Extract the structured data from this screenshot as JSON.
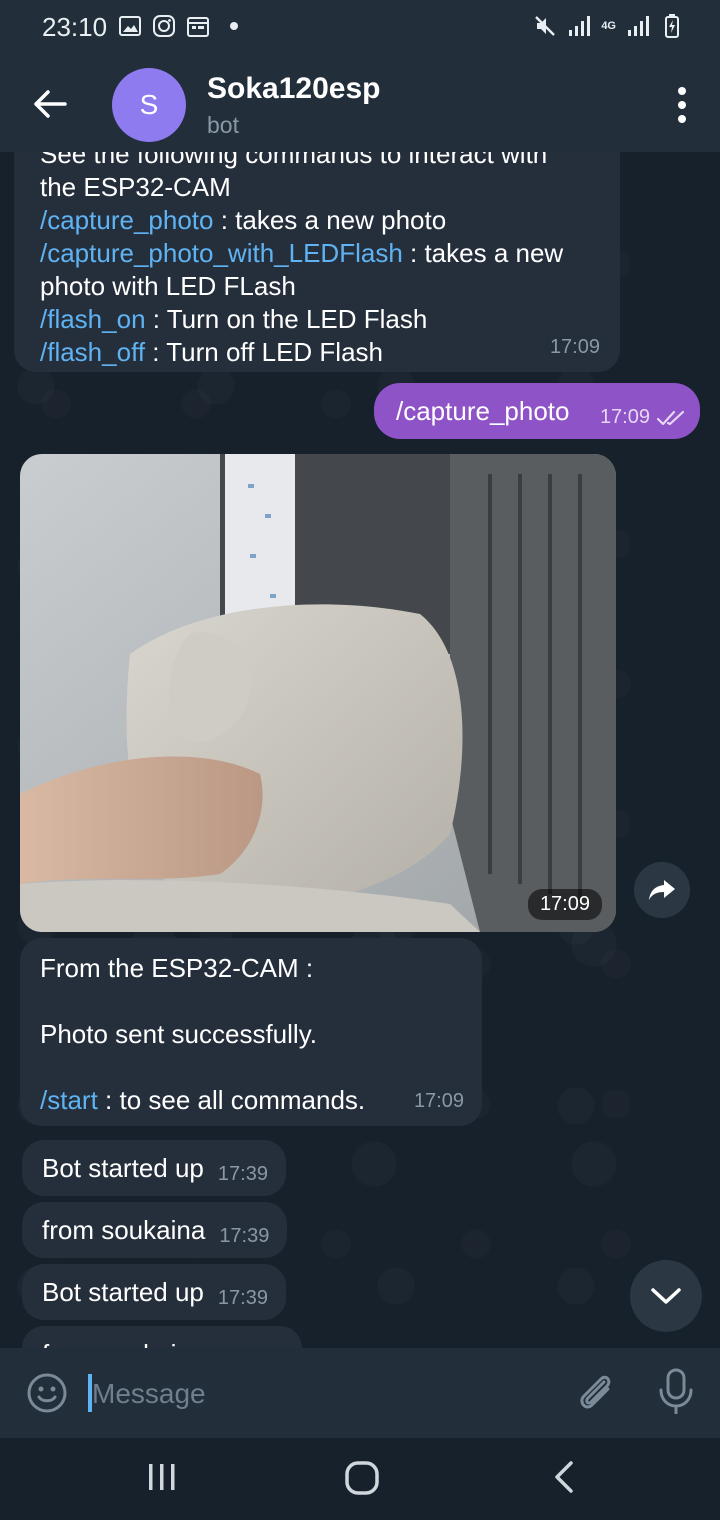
{
  "status_bar": {
    "time": "23:10",
    "network": "4G",
    "left_icons": [
      "gallery-icon",
      "instagram-icon",
      "calendar-icon",
      "dot-icon"
    ],
    "right_icons": [
      "mute-icon",
      "signal-icon",
      "4g-icon",
      "signal-icon",
      "battery-icon"
    ]
  },
  "header": {
    "avatar_letter": "S",
    "avatar_color": "#8e7bf0",
    "title": "Soka120esp",
    "subtitle": "bot"
  },
  "messages": [
    {
      "id": "m1",
      "direction": "incoming",
      "lines": [
        {
          "text": "See the following commands to interact with",
          "cut": true
        },
        {
          "text": "the ESP32-CAM"
        },
        {
          "cmd": "/capture_photo",
          "text": " : takes a new photo"
        },
        {
          "cmd": "/capture_photo_with_LEDFlash",
          "text": " : takes a new"
        },
        {
          "text": "photo with LED FLash"
        },
        {
          "cmd": "/flash_on",
          "text": " : Turn on the LED Flash"
        },
        {
          "cmd": "/flash_off",
          "text": " : Turn off LED Flash"
        }
      ],
      "time": "17:09"
    },
    {
      "id": "m2",
      "direction": "outgoing",
      "text": "/capture_photo",
      "time": "17:09",
      "status": "read"
    },
    {
      "id": "m3",
      "direction": "incoming",
      "type": "photo",
      "time": "17:09"
    },
    {
      "id": "m4",
      "direction": "incoming",
      "line1": "From the ESP32-CAM :",
      "line2": "Photo sent successfully.",
      "cmd": "/start",
      "line3": " : to see all commands.",
      "time": "17:09"
    },
    {
      "id": "m5",
      "direction": "incoming",
      "text": "Bot started up",
      "time": "17:39"
    },
    {
      "id": "m6",
      "direction": "incoming",
      "text": "from soukaina",
      "time": "17:39"
    },
    {
      "id": "m7",
      "direction": "incoming",
      "text": "Bot started up",
      "time": "17:39"
    },
    {
      "id": "m8",
      "direction": "incoming",
      "text": "from soukaina",
      "time": "",
      "cut": true
    }
  ],
  "input": {
    "placeholder": "Message",
    "value": ""
  },
  "colors": {
    "background": "#17212b",
    "bar": "#222e3a",
    "incoming_bubble": "#252f3b",
    "outgoing_bubble": "#8e53c7",
    "command_link": "#5fb3f3"
  }
}
